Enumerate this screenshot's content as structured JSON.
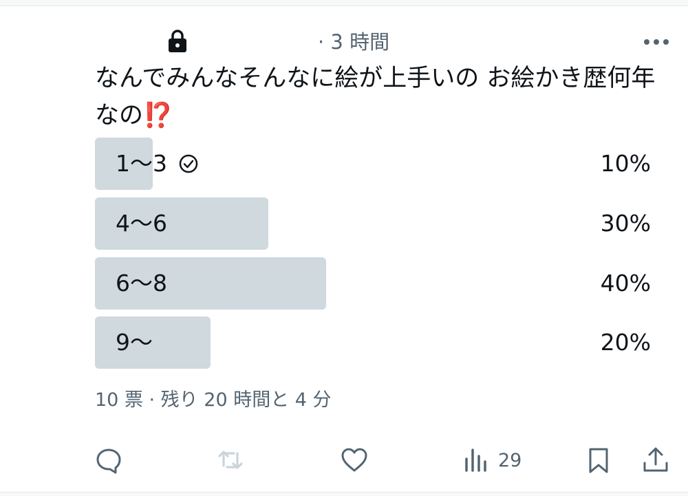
{
  "tweet": {
    "time": "· 3 時間",
    "text_line1": "なんでみんなそんなに絵が上手いの お絵かき歴何年",
    "text_line2": "なの",
    "emoji": "⁉️"
  },
  "poll": {
    "options": [
      {
        "label": "1〜3",
        "percent": "10%",
        "value": 10,
        "selected": true
      },
      {
        "label": "4〜6",
        "percent": "30%",
        "value": 30,
        "selected": false
      },
      {
        "label": "6〜8",
        "percent": "40%",
        "value": 40,
        "selected": false
      },
      {
        "label": "9〜",
        "percent": "20%",
        "value": 20,
        "selected": false
      }
    ],
    "footer": "10 票 · 残り 20 時間と 4 分"
  },
  "actions": {
    "views_count": "29"
  },
  "colors": {
    "bar": "#cfd9de",
    "secondary_text": "#536471",
    "primary_text": "#0f1419",
    "emoji_red": "#e0331e"
  },
  "icons": [
    "lock-icon",
    "more-icon",
    "check-circle-icon",
    "reply-icon",
    "retweet-icon",
    "like-icon",
    "views-icon",
    "bookmark-icon",
    "share-icon"
  ]
}
